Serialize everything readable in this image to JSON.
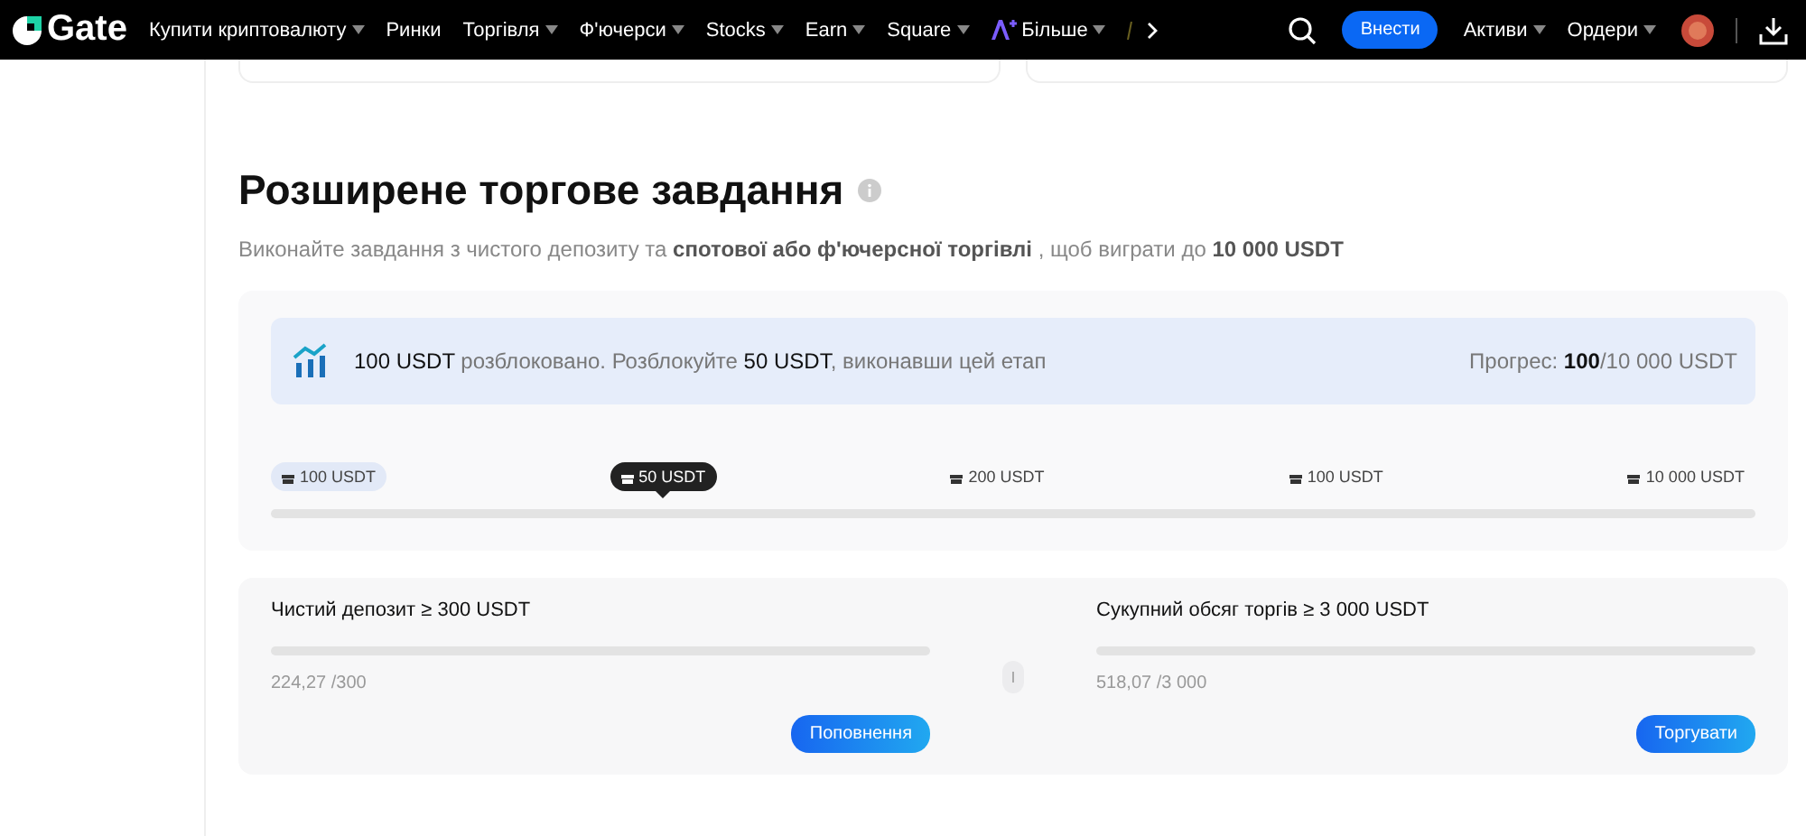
{
  "nav": {
    "logo": "Gate",
    "items": [
      {
        "label": "Купити криптовалюту",
        "dropdown": true
      },
      {
        "label": "Ринки",
        "dropdown": false
      },
      {
        "label": "Торгівля",
        "dropdown": true
      },
      {
        "label": "Ф'ючерси",
        "dropdown": true
      },
      {
        "label": "Stocks",
        "dropdown": true
      },
      {
        "label": "Earn",
        "dropdown": true
      },
      {
        "label": "Square",
        "dropdown": true
      },
      {
        "label": "Більше",
        "dropdown": true,
        "kind": "ai"
      }
    ],
    "deposit_button": "Внести",
    "right_items": [
      {
        "label": "Активи",
        "dropdown": true
      },
      {
        "label": "Ордери",
        "dropdown": true
      }
    ]
  },
  "section": {
    "title": "Розширене торгове завдання",
    "subtitle": "Виконайте завдання з чистого депозиту та **спотової або ф'ючерсної торгівлі** , щоб виграти до **10 000 USDT**",
    "banner": {
      "message": "**100 USDT** розблоковано. Розблокуйте **50 USDT**, виконавши цей етап",
      "progress": "Прогрес: **100**/10 000 USDT"
    },
    "milestones": [
      {
        "label": "100 USDT",
        "kind": "achieved"
      },
      {
        "label": "50 USDT",
        "kind": "current"
      },
      {
        "label": "200 USDT",
        "kind": "pending"
      },
      {
        "label": "100 USDT",
        "kind": "pending"
      },
      {
        "label": "10 000 USDT",
        "kind": "pending"
      }
    ],
    "tasks": [
      {
        "title": "Чистий депозит ≥ 300 USDT",
        "reading": "224,27 /300",
        "button": "Поповнення"
      },
      {
        "title": "Сукупний обсяг торгів ≥ 3 000 USDT",
        "reading": "518,07 /3 000",
        "button": "Торгувати"
      }
    ]
  }
}
